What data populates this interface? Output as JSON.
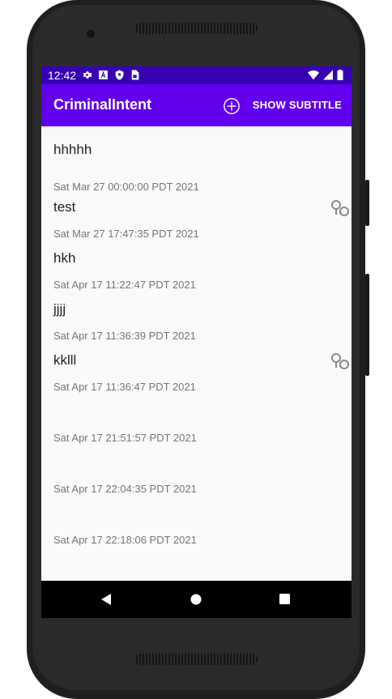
{
  "status_bar": {
    "time": "12:42",
    "left_icons": [
      "gear-icon",
      "font-icon",
      "shield-icon",
      "sim-card-icon"
    ],
    "right_icons": [
      "wifi-icon",
      "signal-icon",
      "battery-icon"
    ]
  },
  "app_bar": {
    "title": "CriminalIntent",
    "add_icon": "add-circle-icon",
    "show_subtitle_label": "SHOW SUBTITLE",
    "background": "#6200ee",
    "status_background": "#3700b3"
  },
  "crimes": [
    {
      "title": "hhhhh",
      "date": "Sat Mar 27 00:00:00 PDT 2021",
      "solved": false
    },
    {
      "title": "test",
      "date": "Sat Mar 27 17:47:35 PDT 2021",
      "solved": true
    },
    {
      "title": "hkh",
      "date": "Sat Apr 17 11:22:47 PDT 2021",
      "solved": false
    },
    {
      "title": "jjjj",
      "date": "Sat Apr 17 11:36:39 PDT 2021",
      "solved": false
    },
    {
      "title": "kklll",
      "date": "Sat Apr 17 11:36:47 PDT 2021",
      "solved": true
    },
    {
      "title": "",
      "date": "Sat Apr 17 21:51:57 PDT 2021",
      "solved": false
    },
    {
      "title": "",
      "date": "Sat Apr 17 22:04:35 PDT 2021",
      "solved": false
    },
    {
      "title": "",
      "date": "Sat Apr 17 22:18:06 PDT 2021",
      "solved": false
    }
  ],
  "nav_bar": {
    "buttons": [
      "back-icon",
      "home-icon",
      "recents-icon"
    ]
  }
}
